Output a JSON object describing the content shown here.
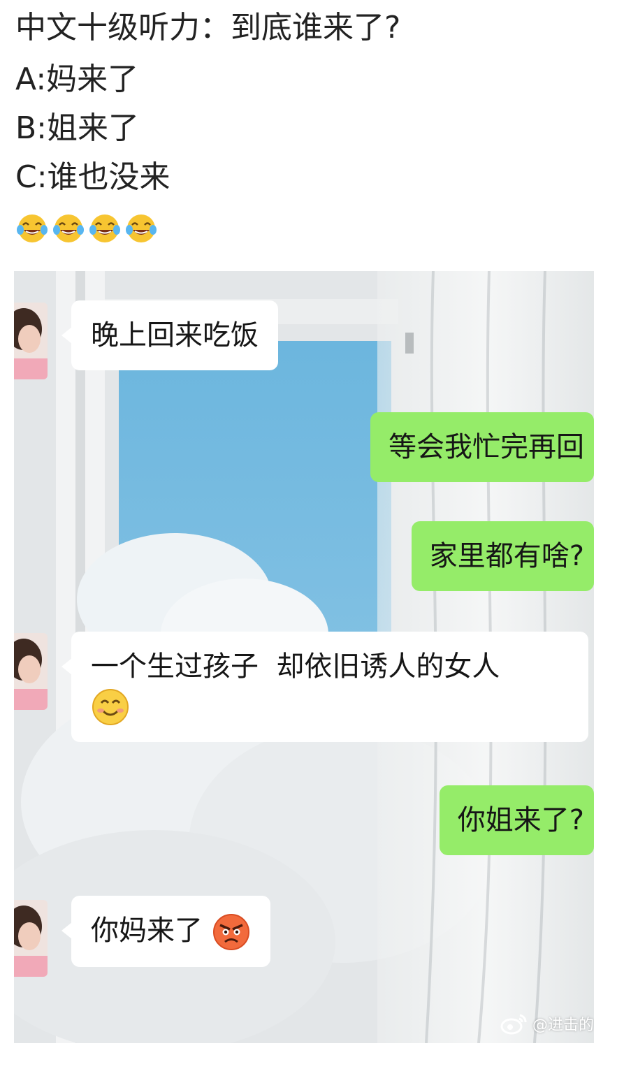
{
  "post": {
    "title": "中文十级听力：到底谁来了?",
    "option_a": "A:妈来了",
    "option_b": "B:姐来了",
    "option_c": "C:谁也没来",
    "emojis": [
      "laughing-tears-emoji",
      "laughing-tears-emoji",
      "laughing-tears-emoji",
      "laughing-tears-emoji"
    ]
  },
  "chat": {
    "messages": [
      {
        "side": "left",
        "text": "晚上回来吃饭"
      },
      {
        "side": "right",
        "text": "等会我忙完再回"
      },
      {
        "side": "right",
        "text": "家里都有啥?"
      },
      {
        "side": "left",
        "text": "一个生过孩子  却依旧诱人的女人",
        "emoji": "smiling-face-emoji"
      },
      {
        "side": "right",
        "text": "你姐来了?"
      },
      {
        "side": "left",
        "text": "你妈来了",
        "emoji": "angry-face-emoji"
      }
    ],
    "colors": {
      "incoming_bubble": "#ffffff",
      "outgoing_bubble": "#95ec69"
    },
    "watermark": {
      "icon": "weibo-icon",
      "text": "@进击的"
    }
  }
}
